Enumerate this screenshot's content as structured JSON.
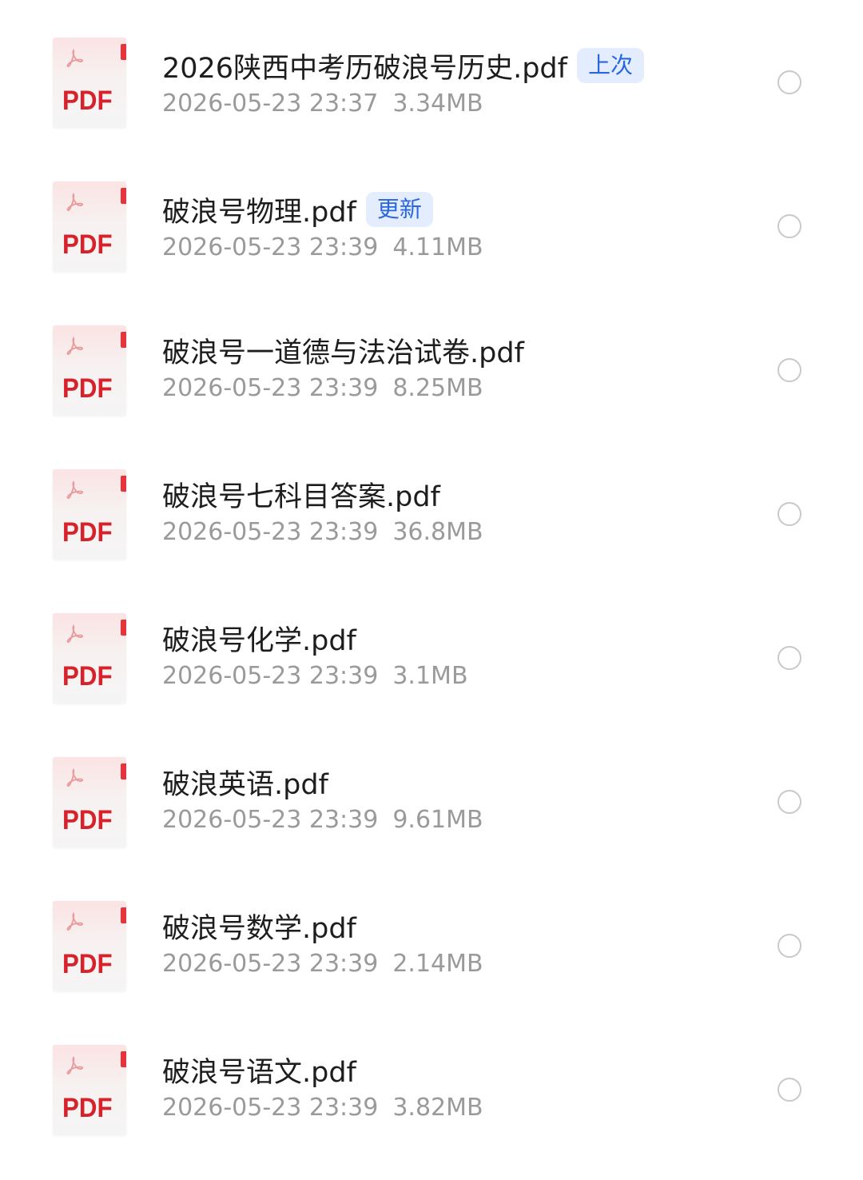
{
  "icons": {
    "file_type": "pdf-file-icon",
    "select": "radio-circle-icon"
  },
  "colors": {
    "pdf_red": "#d8222b",
    "tag_bg": "#e3edfd",
    "tag_text": "#2a66e0",
    "meta_text": "#9a9a9a",
    "name_text": "#1d1d1d"
  },
  "files": [
    {
      "icon_label": "PDF",
      "name": "2026陕西中考历破浪号历史.pdf",
      "tag": "上次",
      "date": "2026-05-23 23:37",
      "size": "3.34MB"
    },
    {
      "icon_label": "PDF",
      "name": "破浪号物理.pdf",
      "tag": "更新",
      "date": "2026-05-23 23:39",
      "size": "4.11MB"
    },
    {
      "icon_label": "PDF",
      "name": "破浪号一道德与法治试卷.pdf",
      "tag": "",
      "date": "2026-05-23 23:39",
      "size": "8.25MB"
    },
    {
      "icon_label": "PDF",
      "name": "破浪号七科目答案.pdf",
      "tag": "",
      "date": "2026-05-23 23:39",
      "size": "36.8MB"
    },
    {
      "icon_label": "PDF",
      "name": "破浪号化学.pdf",
      "tag": "",
      "date": "2026-05-23 23:39",
      "size": "3.1MB"
    },
    {
      "icon_label": "PDF",
      "name": "破浪英语.pdf",
      "tag": "",
      "date": "2026-05-23 23:39",
      "size": "9.61MB"
    },
    {
      "icon_label": "PDF",
      "name": "破浪号数学.pdf",
      "tag": "",
      "date": "2026-05-23 23:39",
      "size": "2.14MB"
    },
    {
      "icon_label": "PDF",
      "name": "破浪号语文.pdf",
      "tag": "",
      "date": "2026-05-23 23:39",
      "size": "3.82MB"
    }
  ]
}
